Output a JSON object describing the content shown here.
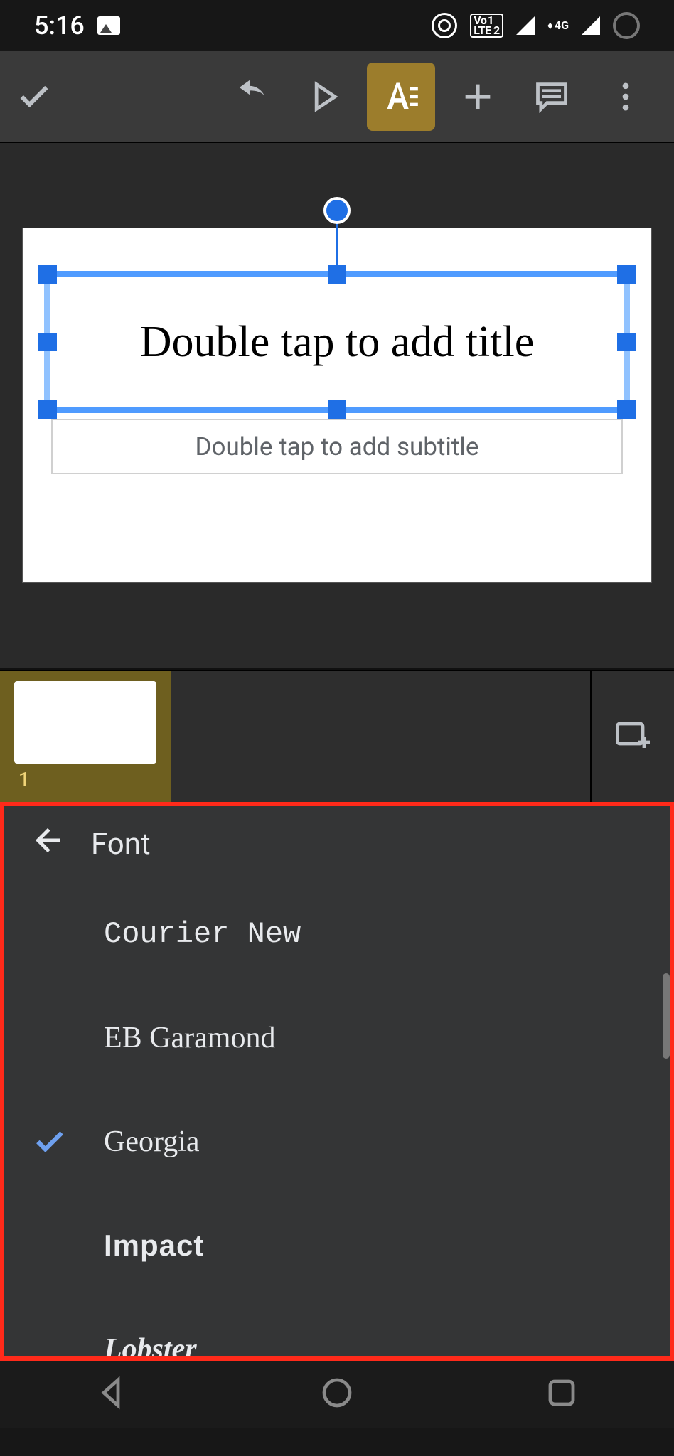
{
  "statusbar": {
    "time": "5:16",
    "network_label": "4G",
    "lte_label": "Vo LTE 2"
  },
  "toolbar": {
    "done": "Done",
    "undo": "Undo",
    "present": "Present",
    "text_format": "Text format",
    "add": "Add",
    "comment": "Comment",
    "more": "More"
  },
  "slide": {
    "title_placeholder": "Double tap to add title",
    "subtitle_placeholder": "Double tap to add subtitle"
  },
  "filmstrip": {
    "current_index": "1",
    "add_slide": "New slide"
  },
  "font_panel": {
    "title": "Font",
    "items": [
      {
        "label": "Courier New",
        "class": "f-courier",
        "selected": false
      },
      {
        "label": "EB Garamond",
        "class": "f-garamond",
        "selected": false
      },
      {
        "label": "Georgia",
        "class": "f-georgia",
        "selected": true
      },
      {
        "label": "Impact",
        "class": "f-impact",
        "selected": false
      },
      {
        "label": "Lobster",
        "class": "f-lobster",
        "selected": false
      }
    ]
  },
  "navbar": {
    "back": "Back",
    "home": "Home",
    "recent": "Recent"
  }
}
